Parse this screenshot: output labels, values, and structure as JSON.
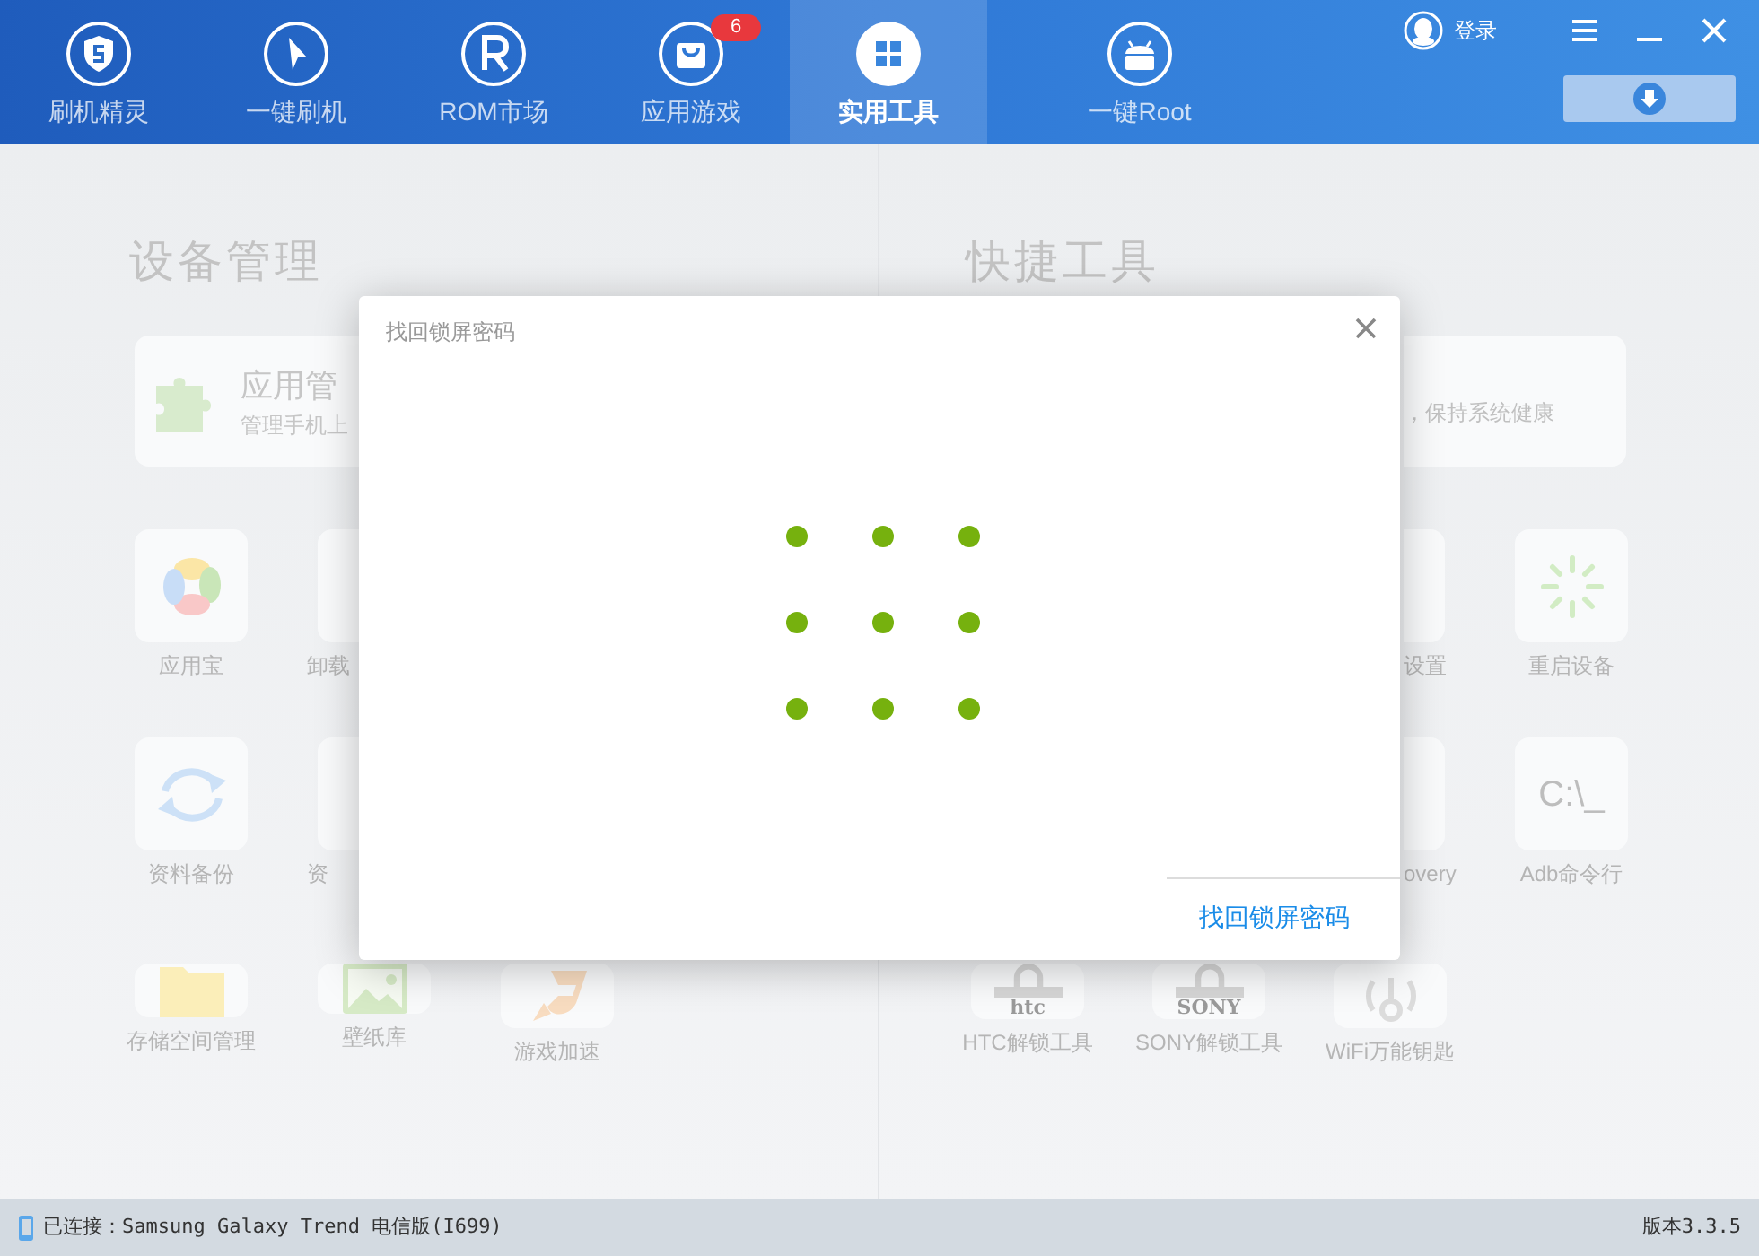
{
  "header": {
    "tabs": [
      {
        "label": "刷机精灵",
        "selected": false
      },
      {
        "label": "一键刷机",
        "selected": false
      },
      {
        "label": "ROM市场",
        "selected": false
      },
      {
        "label": "应用游戏",
        "selected": false,
        "badge": "6"
      },
      {
        "label": "实用工具",
        "selected": true
      },
      {
        "label": "一键Root",
        "selected": false
      }
    ],
    "login": "登录"
  },
  "device_management": {
    "heading": "设备管理",
    "app_manager": {
      "title": "应用管",
      "subtitle": "管理手机上"
    },
    "tool_rows": [
      [
        {
          "label": "应用宝"
        },
        {
          "label": "卸载"
        }
      ],
      [
        {
          "label": "资料备份"
        },
        {
          "label": "资"
        }
      ],
      [
        {
          "label": "存储空间管理"
        },
        {
          "label": "壁纸库"
        },
        {
          "label": "游戏加速"
        }
      ]
    ]
  },
  "quick_tools": {
    "heading": "快捷工具",
    "card": {
      "subtitle": "，保持系统健康"
    },
    "tool_rows": [
      [
        {
          "label": "设置"
        },
        {
          "label": "重启设备"
        }
      ],
      [
        {
          "label": "overy"
        },
        {
          "label": "Adb命令行",
          "icon_text": "C:\\_"
        }
      ],
      [
        {
          "label": "HTC解锁工具",
          "icon_text": "htc"
        },
        {
          "label": "SONY解锁工具",
          "icon_text": "SONY"
        },
        {
          "label": "WiFi万能钥匙"
        }
      ]
    ]
  },
  "dialog": {
    "title": "找回锁屏密码",
    "link": "找回锁屏密码"
  },
  "status_bar": {
    "connection": "已连接：Samsung Galaxy Trend 电信版(I699)",
    "version": "版本3.3.5"
  }
}
